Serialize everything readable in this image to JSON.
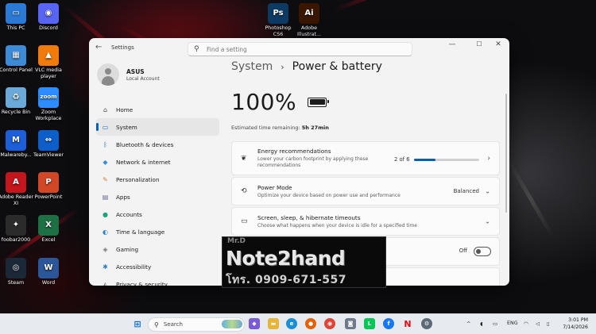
{
  "desktop": {
    "icons": [
      {
        "label": "This PC",
        "color": "#2a7ad5",
        "glyph": "▭"
      },
      {
        "label": "Discord",
        "color": "#5865f2",
        "glyph": "◉"
      },
      {
        "label": "Control Panel",
        "color": "#3d8ad6",
        "glyph": "▦"
      },
      {
        "label": "VLC media player",
        "color": "#f07b0a",
        "glyph": "▲"
      },
      {
        "label": "Recycle Bin",
        "color": "#6aa9d8",
        "glyph": "♻"
      },
      {
        "label": "Zoom Workplace",
        "color": "#2d8cff",
        "glyph": "zoom"
      },
      {
        "label": "Malwareby...",
        "color": "#1c5fd8",
        "glyph": "M"
      },
      {
        "label": "TeamViewer",
        "color": "#0e5ec9",
        "glyph": "⇔"
      },
      {
        "label": "Adobe Reader XI",
        "color": "#c4161c",
        "glyph": "A"
      },
      {
        "label": "PowerPoint",
        "color": "#d24726",
        "glyph": "P"
      },
      {
        "label": "foobar2000",
        "color": "#2b2b2b",
        "glyph": "✦"
      },
      {
        "label": "Excel",
        "color": "#1d7044",
        "glyph": "X"
      },
      {
        "label": "Steam",
        "color": "#1b2838",
        "glyph": "◎"
      },
      {
        "label": "Word",
        "color": "#2b579a",
        "glyph": "W"
      },
      {
        "label": "Photoshop CS6",
        "color": "#0d3a63",
        "glyph": "Ps"
      },
      {
        "label": "Adobe Illustrat...",
        "color": "#3a1600",
        "glyph": "Ai"
      }
    ]
  },
  "window": {
    "app_title": "Settings",
    "search_placeholder": "Find a setting",
    "controls": {
      "minimize": "—",
      "maximize": "☐",
      "close": "✕"
    }
  },
  "profile": {
    "name": "ASUS",
    "account_type": "Local Account"
  },
  "nav": [
    {
      "label": "Home",
      "icon": "home-icon",
      "glyph": "⌂",
      "color": "#444"
    },
    {
      "label": "System",
      "icon": "system-icon",
      "glyph": "▭",
      "color": "#0a6cbd"
    },
    {
      "label": "Bluetooth & devices",
      "icon": "bluetooth-icon",
      "glyph": "ᛒ",
      "color": "#0a6cbd"
    },
    {
      "label": "Network & internet",
      "icon": "wifi-icon",
      "glyph": "◆",
      "color": "#3c8fd1"
    },
    {
      "label": "Personalization",
      "icon": "brush-icon",
      "glyph": "✎",
      "color": "#d87a30"
    },
    {
      "label": "Apps",
      "icon": "apps-icon",
      "glyph": "▤",
      "color": "#6b6b9a"
    },
    {
      "label": "Accounts",
      "icon": "accounts-icon",
      "glyph": "●",
      "color": "#1ba37a"
    },
    {
      "label": "Time & language",
      "icon": "globe-icon",
      "glyph": "◐",
      "color": "#2f7fc4"
    },
    {
      "label": "Gaming",
      "icon": "gamepad-icon",
      "glyph": "◈",
      "color": "#777"
    },
    {
      "label": "Accessibility",
      "icon": "accessibility-icon",
      "glyph": "✱",
      "color": "#2f7fc4"
    },
    {
      "label": "Privacy & security",
      "icon": "shield-icon",
      "glyph": "◭",
      "color": "#777"
    }
  ],
  "active_nav": "System",
  "breadcrumb": {
    "parent": "System",
    "separator": "›",
    "current": "Power & battery"
  },
  "battery": {
    "percent_text": "100%",
    "level": 1.0,
    "remaining_label": "Estimated time remaining:",
    "remaining_value": "5h 27min"
  },
  "cards": {
    "energy": {
      "title": "Energy recommendations",
      "desc_line1": "Lower your carbon footprint by applying these",
      "desc_line2": "recommendations",
      "count": "2 of 6",
      "progress": 0.333
    },
    "power_mode": {
      "title": "Power Mode",
      "desc": "Optimize your device based on power use and performance",
      "value": "Balanced"
    },
    "timeouts": {
      "title": "Screen, sleep, & hibernate timeouts",
      "desc": "Choose what happens when your device is idle for a specified time"
    },
    "saver": {
      "toggle_label": "Off",
      "toggle_on": false
    }
  },
  "watermark": {
    "top": "Mr.D",
    "brand": "Note2hand",
    "phone": "โทร. 0909-671-557"
  },
  "taskbar": {
    "search_label": "Search",
    "tray": {
      "chevron": "^",
      "lang": "ENG",
      "time": "3:01 PM",
      "date": "7/14/2026"
    }
  },
  "colors": {
    "accent": "#005fb8",
    "window_bg": "#f3f3f3",
    "taskbar_bg": "#e7ebf0"
  }
}
